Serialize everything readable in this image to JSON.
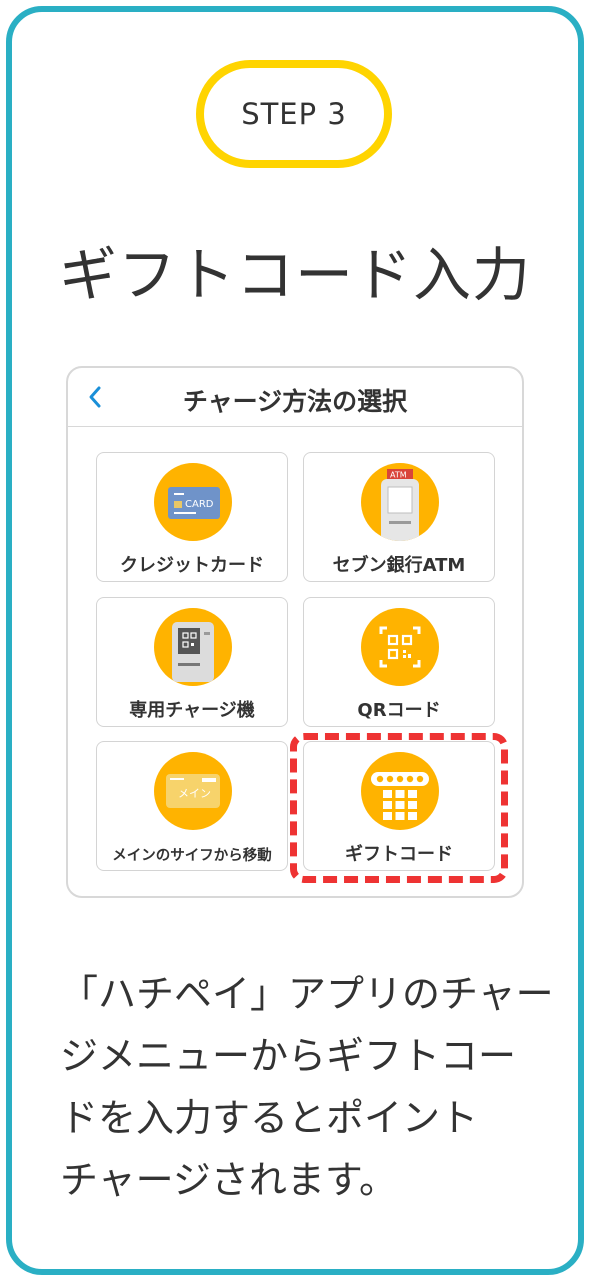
{
  "step": {
    "label": "STEP 3"
  },
  "title": "ギフトコード入力",
  "screen": {
    "header_title": "チャージ方法の選択",
    "back_icon": "chevron-left-icon",
    "tiles": [
      {
        "label": "クレジットカード",
        "icon": "credit-card-icon",
        "icon_text": "CARD"
      },
      {
        "label": "セブン銀行ATM",
        "icon": "atm-icon",
        "icon_text": "ATM"
      },
      {
        "label": "専用チャージ機",
        "icon": "charge-machine-icon"
      },
      {
        "label": "QRコード",
        "icon": "qr-code-icon"
      },
      {
        "label": "メインのサイフから移動",
        "icon": "wallet-card-icon",
        "icon_text": "メイン"
      },
      {
        "label": "ギフトコード",
        "icon": "gift-code-keypad-icon"
      }
    ]
  },
  "description": {
    "lines": [
      "「ハチペイ」アプリのチャー",
      "ジメニューからギフトコー",
      "ドを入力するとポイント",
      "チャージされます。"
    ]
  },
  "colors": {
    "frame": "#2aafc4",
    "badge": "#ffd400",
    "icon_circle": "#ffb300",
    "highlight": "#ee3333",
    "back_chevron": "#1a8fd8"
  }
}
